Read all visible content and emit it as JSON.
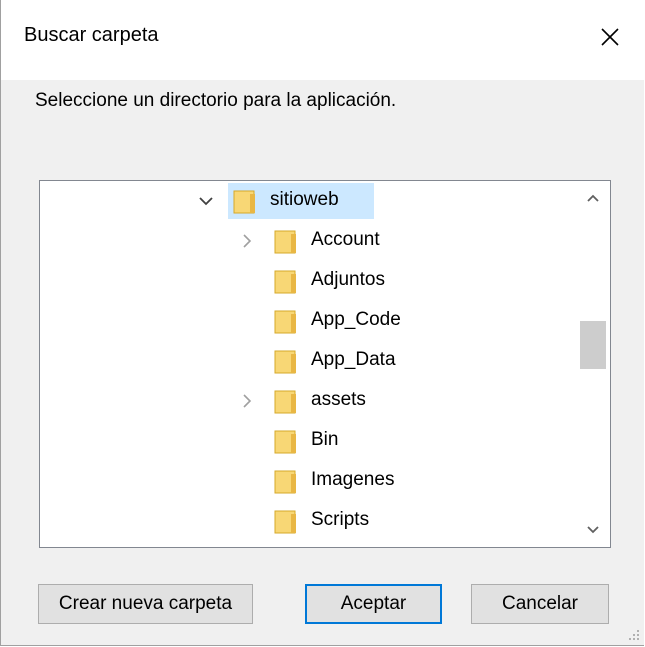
{
  "window": {
    "title": "Buscar carpeta",
    "close_icon": "close-icon"
  },
  "prompt": "Seleccione un directorio para la aplicación.",
  "tree": {
    "items": [
      {
        "label": "sitioweb",
        "expanded": true,
        "selected": true,
        "has_children": true
      },
      {
        "label": "Account",
        "expanded": false,
        "selected": false,
        "has_children": true
      },
      {
        "label": "Adjuntos",
        "expanded": false,
        "selected": false,
        "has_children": false
      },
      {
        "label": "App_Code",
        "expanded": false,
        "selected": false,
        "has_children": false
      },
      {
        "label": "App_Data",
        "expanded": false,
        "selected": false,
        "has_children": false
      },
      {
        "label": "assets",
        "expanded": false,
        "selected": false,
        "has_children": true
      },
      {
        "label": "Bin",
        "expanded": false,
        "selected": false,
        "has_children": false
      },
      {
        "label": "Imagenes",
        "expanded": false,
        "selected": false,
        "has_children": false
      },
      {
        "label": "Scripts",
        "expanded": false,
        "selected": false,
        "has_children": false
      }
    ]
  },
  "buttons": {
    "new_folder": "Crear nueva carpeta",
    "ok": "Aceptar",
    "cancel": "Cancelar"
  },
  "colors": {
    "selection": "#cce8ff",
    "folder": "#f8d775",
    "accent": "#0078d7"
  }
}
